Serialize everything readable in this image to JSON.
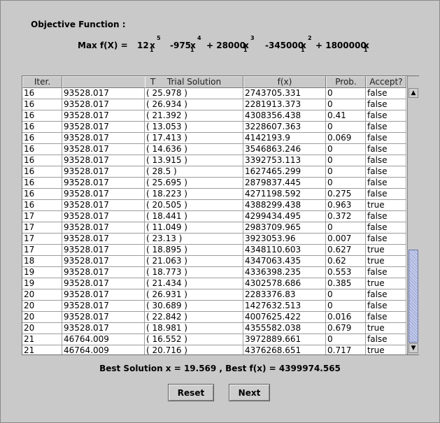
{
  "objective": {
    "title": "Objective Function :",
    "prefix": "Max  f(X) =",
    "terms": [
      {
        "coef": "12",
        "var": "x",
        "sub": "1",
        "exp": "5"
      },
      {
        "coef": "-975",
        "var": "x",
        "sub": "1",
        "exp": "4"
      },
      {
        "coef": "+  28000",
        "var": "x",
        "sub": "1",
        "exp": "3"
      },
      {
        "coef": "-345000",
        "var": "x",
        "sub": "1",
        "exp": "2"
      },
      {
        "coef": "+  1800000",
        "var": "x",
        "sub": "1",
        "exp": ""
      }
    ]
  },
  "table": {
    "headers": [
      "Iter.",
      "T",
      "Trial Solution",
      "f(x)",
      "Prob.",
      "Accept?"
    ],
    "rows": [
      [
        "16",
        "93528.017",
        "( 25.978 )",
        "2743705.331",
        "0",
        "false"
      ],
      [
        "16",
        "93528.017",
        "( 26.934 )",
        "2281913.373",
        "0",
        "false"
      ],
      [
        "16",
        "93528.017",
        "( 21.392 )",
        "4308356.438",
        "0.41",
        "false"
      ],
      [
        "16",
        "93528.017",
        "( 13.053 )",
        "3228607.363",
        "0",
        "false"
      ],
      [
        "16",
        "93528.017",
        "( 17.413 )",
        "4142193.9",
        "0.069",
        "false"
      ],
      [
        "16",
        "93528.017",
        "( 14.636 )",
        "3546863.246",
        "0",
        "false"
      ],
      [
        "16",
        "93528.017",
        "( 13.915 )",
        "3392753.113",
        "0",
        "false"
      ],
      [
        "16",
        "93528.017",
        "( 28.5 )",
        "1627465.299",
        "0",
        "false"
      ],
      [
        "16",
        "93528.017",
        "( 25.695 )",
        "2879837.445",
        "0",
        "false"
      ],
      [
        "16",
        "93528.017",
        "( 18.223 )",
        "4271198.592",
        "0.275",
        "false"
      ],
      [
        "16",
        "93528.017",
        "( 20.505 )",
        "4388299.438",
        "0.963",
        "true"
      ],
      [
        "17",
        "93528.017",
        "( 18.441 )",
        "4299434.495",
        "0.372",
        "false"
      ],
      [
        "17",
        "93528.017",
        "( 11.049 )",
        "2983709.965",
        "0",
        "false"
      ],
      [
        "17",
        "93528.017",
        "( 23.13 )",
        "3923053.96",
        "0.007",
        "false"
      ],
      [
        "17",
        "93528.017",
        "( 18.895 )",
        "4348110.603",
        "0.627",
        "true"
      ],
      [
        "18",
        "93528.017",
        "( 21.063 )",
        "4347063.435",
        "0.62",
        "true"
      ],
      [
        "19",
        "93528.017",
        "( 18.773 )",
        "4336398.235",
        "0.553",
        "false"
      ],
      [
        "19",
        "93528.017",
        "( 21.434 )",
        "4302578.686",
        "0.385",
        "true"
      ],
      [
        "20",
        "93528.017",
        "( 26.931 )",
        "2283376.83",
        "0",
        "false"
      ],
      [
        "20",
        "93528.017",
        "( 30.689 )",
        "1427632.513",
        "0",
        "false"
      ],
      [
        "20",
        "93528.017",
        "( 22.842 )",
        "4007625.422",
        "0.016",
        "false"
      ],
      [
        "20",
        "93528.017",
        "( 18.981 )",
        "4355582.038",
        "0.679",
        "true"
      ],
      [
        "21",
        "46764.009",
        "( 16.552 )",
        "3972889.661",
        "0",
        "false"
      ],
      [
        "21",
        "46764.009",
        "( 20.716 )",
        "4376268.651",
        "0.717",
        "true"
      ]
    ]
  },
  "scrollbar": {
    "up_icon": "arrow-up-icon",
    "down_icon": "arrow-down-icon",
    "up_glyph": "▲",
    "down_glyph": "▼"
  },
  "best_solution": "Best Solution x = 19.569 , Best f(x) = 4399974.565",
  "buttons": {
    "reset": "Reset",
    "next": "Next"
  }
}
